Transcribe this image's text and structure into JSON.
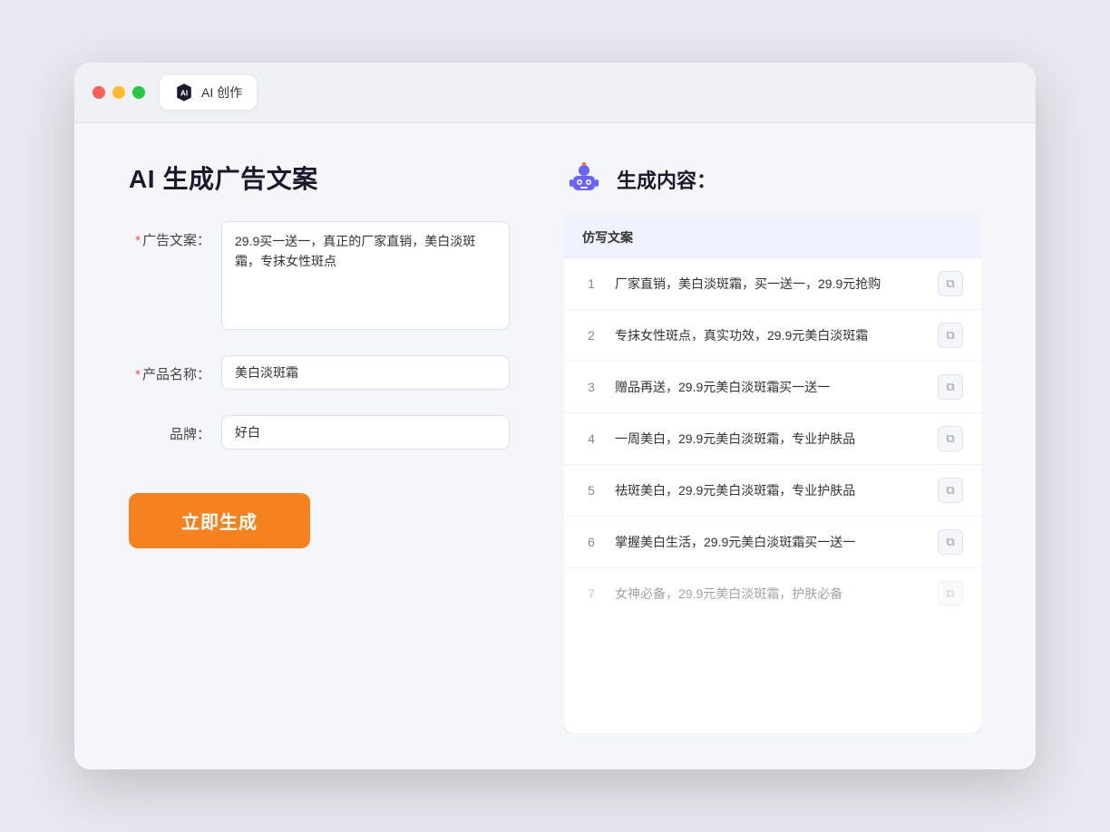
{
  "browser": {
    "tab_label": "AI 创作"
  },
  "page": {
    "title": "AI 生成广告文案",
    "result_title": "生成内容："
  },
  "form": {
    "ad_copy_label": "广告文案：",
    "product_name_label": "产品名称：",
    "brand_label": "品牌：",
    "ad_copy_required": "*",
    "product_name_required": "*",
    "ad_copy_value": "29.9买一送一，真正的厂家直销，美白淡斑霜，专抹女性斑点",
    "product_name_value": "美白淡斑霜",
    "brand_value": "好白",
    "generate_btn_label": "立即生成"
  },
  "results": {
    "column_header": "仿写文案",
    "items": [
      {
        "num": "1",
        "text": "厂家直销，美白淡斑霜，买一送一，29.9元抢购",
        "dimmed": false
      },
      {
        "num": "2",
        "text": "专抹女性斑点，真实功效，29.9元美白淡斑霜",
        "dimmed": false
      },
      {
        "num": "3",
        "text": "赠品再送，29.9元美白淡斑霜买一送一",
        "dimmed": false
      },
      {
        "num": "4",
        "text": "一周美白，29.9元美白淡斑霜，专业护肤品",
        "dimmed": false
      },
      {
        "num": "5",
        "text": "祛斑美白，29.9元美白淡斑霜，专业护肤品",
        "dimmed": false
      },
      {
        "num": "6",
        "text": "掌握美白生活，29.9元美白淡斑霜买一送一",
        "dimmed": false
      },
      {
        "num": "7",
        "text": "女神必备，29.9元美白淡斑霜，护肤必备",
        "dimmed": true
      }
    ]
  }
}
